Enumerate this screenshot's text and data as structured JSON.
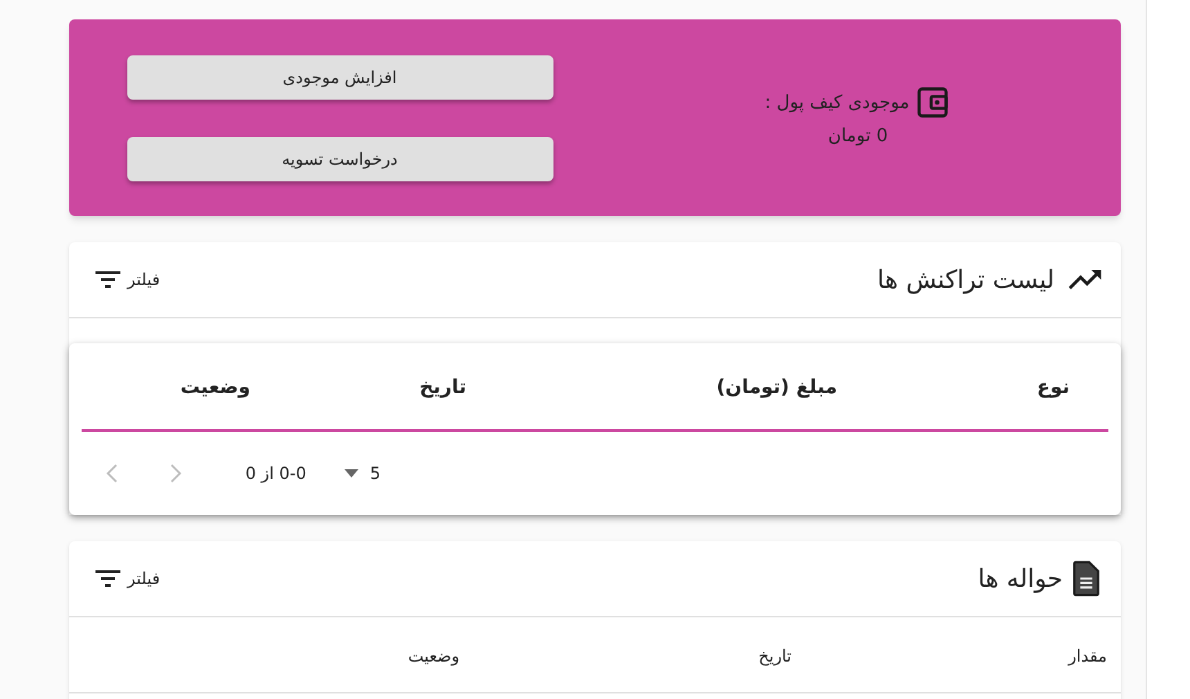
{
  "wallet": {
    "label": "موجودی کیف پول :",
    "amount": "0 تومان",
    "buttons": [
      "افزایش موجودی",
      "درخواست تسویه"
    ]
  },
  "transactions": {
    "title": "لیست تراکنش ها",
    "filter": "فیلتر",
    "columns": [
      "نوع",
      "مبلغ (تومان)",
      "تاریخ",
      "وضعیت"
    ],
    "pagination": {
      "rows_per_page": "5",
      "range": "0-0 از 0",
      "prev_disabled": true,
      "next_disabled": true
    }
  },
  "transfers": {
    "title": "حواله ها",
    "filter": "فیلتر",
    "columns": [
      "مقدار",
      "تاریخ",
      "وضعیت"
    ]
  }
}
